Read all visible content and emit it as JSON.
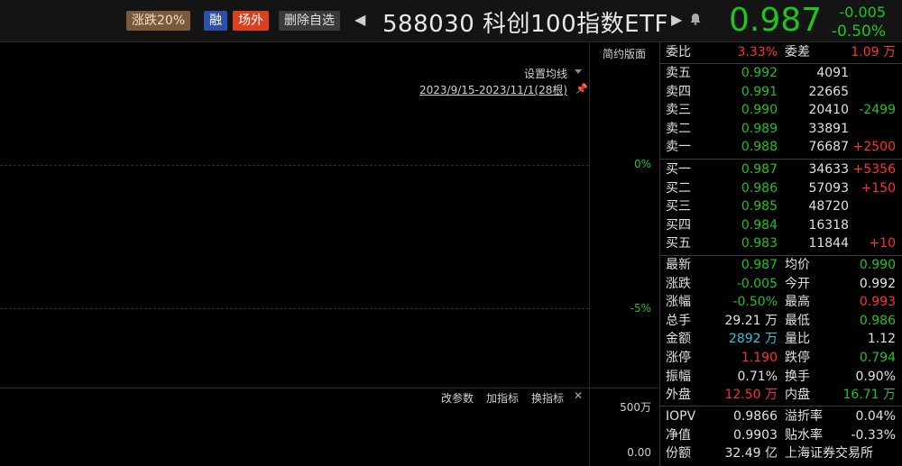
{
  "header": {
    "tag_limit": "涨跌20%",
    "tag_rong": "融",
    "tag_otc": "场外",
    "tag_delete": "删除自选",
    "prev_arrow": "◀",
    "title": "588030 科创100指数ETF",
    "next_arrow": "▶",
    "bell_icon": "🔔",
    "price": "0.987",
    "change": "-0.005",
    "change_pct": "-0.50%"
  },
  "chart": {
    "view_toggle": "简约版面",
    "ma_settings": "设置均线",
    "date_range": "2023/9/15-2023/11/1(28根)",
    "axis_top": "0%",
    "axis_mid": "-5%",
    "indicator_params": "改参数",
    "add_indicator": "加指标",
    "switch_indicator": "换指标",
    "close_icon": "✕",
    "vol_top": "500万",
    "vol_bottom": "0.00"
  },
  "panel": {
    "wei_bi_label": "委比",
    "wei_bi": "3.33%",
    "wei_cha_label": "委差",
    "wei_cha": "1.09 万",
    "asks": [
      {
        "label": "卖五",
        "price": "0.992",
        "vol": "4091",
        "chg": ""
      },
      {
        "label": "卖四",
        "price": "0.991",
        "vol": "22665",
        "chg": ""
      },
      {
        "label": "卖三",
        "price": "0.990",
        "vol": "20410",
        "chg": "-2499"
      },
      {
        "label": "卖二",
        "price": "0.989",
        "vol": "33891",
        "chg": ""
      },
      {
        "label": "卖一",
        "price": "0.988",
        "vol": "76687",
        "chg": "+2500"
      }
    ],
    "bids": [
      {
        "label": "买一",
        "price": "0.987",
        "vol": "34633",
        "chg": "+5356"
      },
      {
        "label": "买二",
        "price": "0.986",
        "vol": "57093",
        "chg": "+150"
      },
      {
        "label": "买三",
        "price": "0.985",
        "vol": "48720",
        "chg": ""
      },
      {
        "label": "买四",
        "price": "0.984",
        "vol": "16318",
        "chg": ""
      },
      {
        "label": "买五",
        "price": "0.983",
        "vol": "11844",
        "chg": "+10"
      }
    ],
    "stats": [
      {
        "l1": "最新",
        "v1": "0.987",
        "l2": "均价",
        "v2": "0.990"
      },
      {
        "l1": "涨跌",
        "v1": "-0.005",
        "l2": "今开",
        "v2": "0.992"
      },
      {
        "l1": "涨幅",
        "v1": "-0.50%",
        "l2": "最高",
        "v2": "0.993"
      },
      {
        "l1": "总手",
        "v1": "29.21 万",
        "l2": "最低",
        "v2": "0.986"
      },
      {
        "l1": "金额",
        "v1": "2892 万",
        "l2": "量比",
        "v2": "1.12"
      },
      {
        "l1": "涨停",
        "v1": "1.190",
        "l2": "跌停",
        "v2": "0.794"
      },
      {
        "l1": "振幅",
        "v1": "0.71%",
        "l2": "换手",
        "v2": "0.90%"
      },
      {
        "l1": "外盘",
        "v1": "12.50 万",
        "l2": "内盘",
        "v2": "16.71 万"
      }
    ],
    "extra": [
      {
        "l1": "IOPV",
        "v1": "0.9866",
        "l2": "溢折率",
        "v2": "0.04%"
      },
      {
        "l1": "净值",
        "v1": "0.9903",
        "l2": "贴水率",
        "v2": "-0.33%"
      },
      {
        "l1": "份额",
        "v1": "32.49 亿",
        "l2": "上海证券交易所",
        "v2": ""
      }
    ],
    "colors": {
      "up": "#ff3030",
      "down": "#1fc41f",
      "neutral": "#e0e0e0",
      "cyan": "#2ec4d6"
    }
  }
}
